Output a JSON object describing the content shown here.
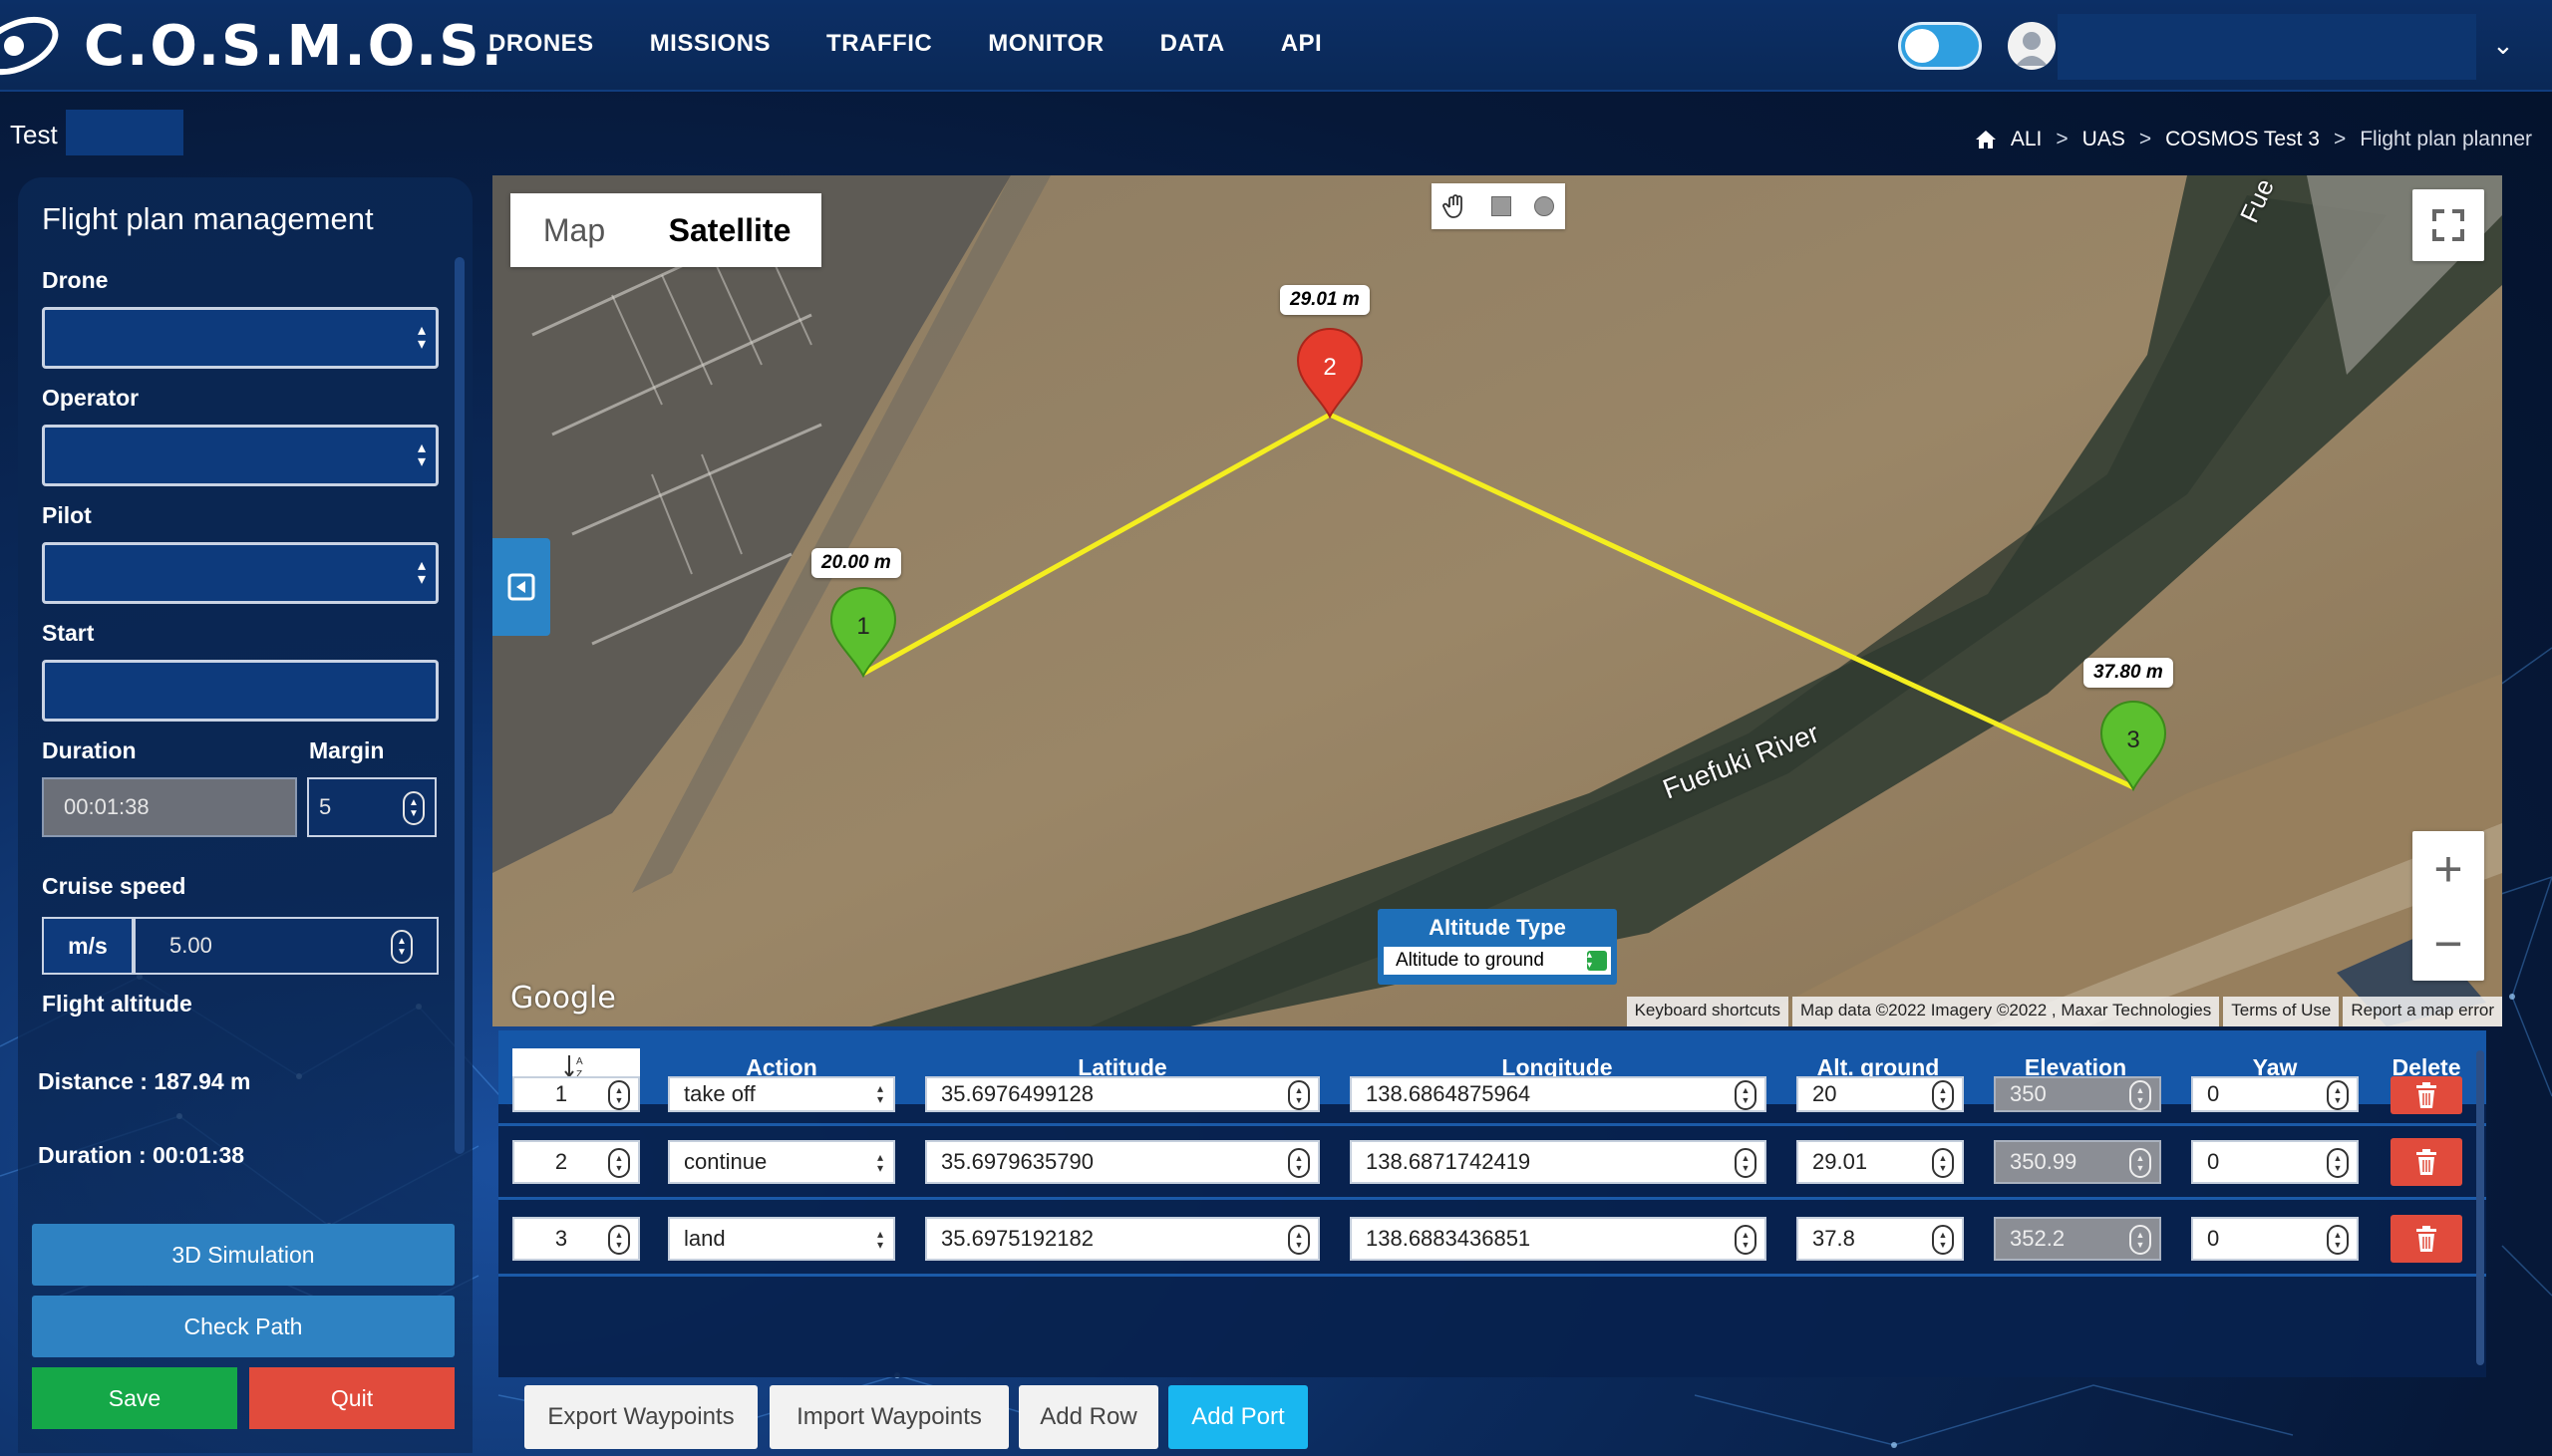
{
  "app": {
    "brand": "C.O.S.M.O.S.",
    "nav": [
      "DRONES",
      "MISSIONS",
      "TRAFFIC",
      "MONITOR",
      "DATA",
      "API"
    ],
    "project_label": "Test I"
  },
  "breadcrumb": [
    "ALI",
    "UAS",
    "COSMOS Test 3",
    "Flight plan planner"
  ],
  "panel": {
    "title": "Flight plan management",
    "drone_label": "Drone",
    "operator_label": "Operator",
    "pilot_label": "Pilot",
    "start_label": "Start",
    "duration_label": "Duration",
    "duration_value": "00:01:38",
    "margin_label": "Margin",
    "margin_value": "5",
    "cruise_label": "Cruise speed",
    "cruise_unit": "m/s",
    "cruise_value": "5.00",
    "altitude_label": "Flight altitude",
    "distance_text": "Distance : 187.94 m",
    "duration_text": "Duration : 00:01:38",
    "sim_button": "3D Simulation",
    "check_button": "Check Path",
    "save_button": "Save",
    "quit_button": "Quit"
  },
  "map": {
    "type_map": "Map",
    "type_satellite": "Satellite",
    "labels": {
      "d1": "20.00 m",
      "d2": "29.01 m",
      "d3": "37.80 m"
    },
    "marker_numbers": [
      "1",
      "2",
      "3"
    ],
    "river": "Fuefuki River",
    "road": "Fue",
    "google": "Google",
    "altitude_type_title": "Altitude Type",
    "altitude_type_value": "Altitude to ground",
    "attribution": [
      "Keyboard shortcuts",
      "Map data ©2022 Imagery ©2022 , Maxar Technologies",
      "Terms of Use",
      "Report a map error"
    ],
    "zoom_in": "+",
    "zoom_out": "−"
  },
  "table": {
    "headers": {
      "action": "Action",
      "latitude": "Latitude",
      "longitude": "Longitude",
      "alt": "Alt. ground",
      "elev": "Elevation",
      "yaw": "Yaw",
      "del": "Delete"
    },
    "rows": [
      {
        "n": "1",
        "action": "take off",
        "lat": "35.6976499128",
        "lon": "138.6864875964",
        "alt": "20",
        "elev": "350",
        "yaw": "0"
      },
      {
        "n": "2",
        "action": "continue",
        "lat": "35.6979635790",
        "lon": "138.6871742419",
        "alt": "29.01",
        "elev": "350.99",
        "yaw": "0"
      },
      {
        "n": "3",
        "action": "land",
        "lat": "35.6975192182",
        "lon": "138.6883436851",
        "alt": "37.8",
        "elev": "352.2",
        "yaw": "0"
      }
    ]
  },
  "buttons": {
    "export": "Export Waypoints",
    "import": "Import Waypoints",
    "add_row": "Add Row",
    "add_port": "Add Port"
  },
  "colors": {
    "accent": "#2e82c2",
    "save": "#15a848",
    "quit": "#e14b3c",
    "route": "#f4ee1f",
    "marker_start": "#5bbf2e",
    "marker_mid": "#e53b2c"
  }
}
